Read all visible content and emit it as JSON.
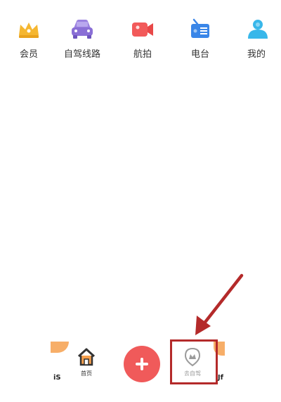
{
  "top_nav": {
    "items": [
      {
        "label": "会员",
        "icon": "crown-icon",
        "color": "#f5b731"
      },
      {
        "label": "自驾线路",
        "icon": "car-icon",
        "color": "#8a6fd6"
      },
      {
        "label": "航拍",
        "icon": "camera-icon",
        "color": "#f25a5a"
      },
      {
        "label": "电台",
        "icon": "radio-icon",
        "color": "#3a86e8"
      },
      {
        "label": "我的",
        "icon": "person-icon",
        "color": "#38b7ea"
      }
    ]
  },
  "bottom_bar": {
    "home": {
      "label": "首页",
      "icon": "home-icon"
    },
    "add": {
      "icon": "plus-icon",
      "color": "#f05a5a"
    },
    "selfdrive": {
      "label": "去自驾",
      "icon": "map-pin-icon"
    },
    "left_mark": "iS",
    "right_mark": "Jf"
  },
  "annotation": {
    "color": "#b42a2a"
  }
}
